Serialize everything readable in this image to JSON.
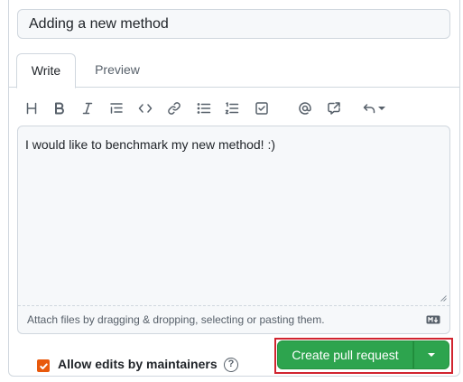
{
  "form": {
    "title_value": "Adding a new method",
    "tabs": [
      {
        "label": "Write",
        "active": true
      },
      {
        "label": "Preview",
        "active": false
      }
    ],
    "toolbar_icons": [
      "heading-icon",
      "bold-icon",
      "italic-icon",
      "quote-icon",
      "code-icon",
      "link-icon",
      "unordered-list-icon",
      "ordered-list-icon",
      "task-list-icon",
      "mention-icon",
      "cross-reference-icon",
      "saved-replies-icon"
    ],
    "body_value": "I would like to benchmark my new method! :)",
    "attach_hint": "Attach files by dragging & dropping, selecting or pasting them.",
    "allow_edits_label": "Allow edits by maintainers",
    "allow_edits_checked": true,
    "help_glyph": "?",
    "create_button_label": "Create pull request"
  },
  "colors": {
    "primary_button": "#2da44e",
    "checkbox": "#e8590c",
    "highlight_border": "#d1242f"
  }
}
